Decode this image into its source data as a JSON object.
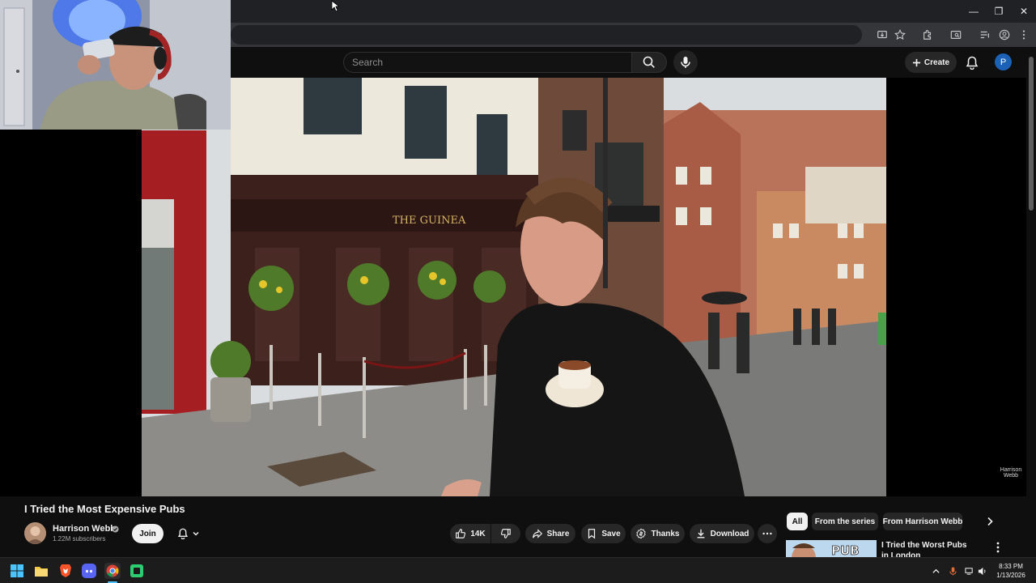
{
  "window_controls": {
    "minimize": "—",
    "restore": "❐",
    "close": "✕"
  },
  "search": {
    "placeholder": "Search"
  },
  "masthead": {
    "create_label": "Create",
    "profile_initial": "P"
  },
  "colors": {
    "youtube_bg": "#0f0f0f",
    "accent_blue": "#065fd4",
    "profile_blue": "#1a61b7",
    "pill_bg": "#272727"
  },
  "video": {
    "title": "I Tried the Most Expensive Pubs",
    "storefront_sign": "THE GUINEA",
    "watermark": "Harrison Webb"
  },
  "channel": {
    "name": "Harrison Webb",
    "subscribers": "1.22M subscribers",
    "join_label": "Join"
  },
  "actions": {
    "like_count": "14K",
    "share": "Share",
    "save": "Save",
    "thanks": "Thanks",
    "download": "Download"
  },
  "chips": [
    "All",
    "From the series",
    "From Harrison Webb"
  ],
  "recommendation": {
    "title": "I Tried the Worst Pubs in London",
    "thumb_text": "PUB"
  },
  "taskbar": {
    "time": "8:33 PM",
    "date": "1/13/2026",
    "icons": [
      "windows-start-icon",
      "file-explorer-icon",
      "brave-browser-icon",
      "discord-icon",
      "chrome-icon",
      "media-app-icon"
    ]
  }
}
